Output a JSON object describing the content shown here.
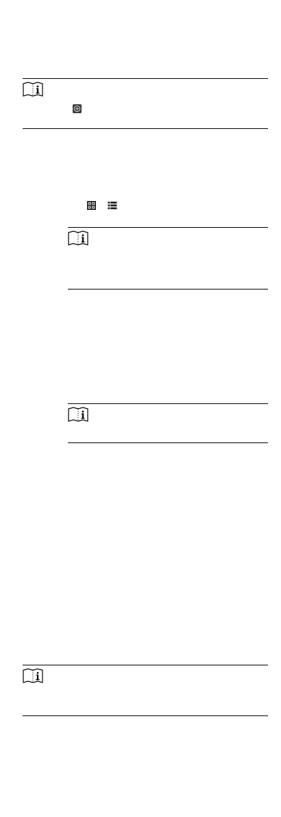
{
  "page": {
    "note_icons": [
      "note-book-info-icon",
      "note-book-info-icon",
      "note-book-info-icon",
      "note-book-info-icon"
    ],
    "inline_icons": [
      "add-circle-icon",
      "thumbnail-view-icon",
      "list-view-icon"
    ]
  }
}
